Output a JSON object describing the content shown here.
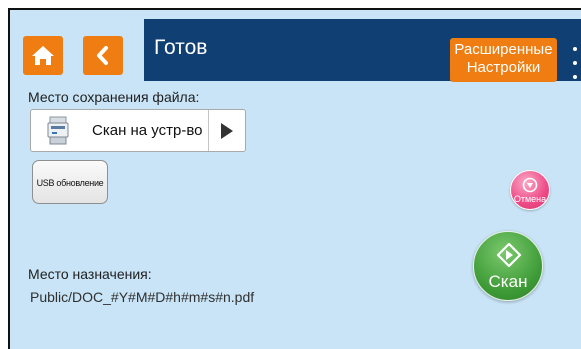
{
  "header": {
    "title": "Готов",
    "advanced_settings_label": "Расширенные Настройки"
  },
  "save_location": {
    "label": "Место сохранения файла:",
    "selected_value": "Скан на устр-во"
  },
  "usb_update": {
    "label": "USB обновление"
  },
  "cancel": {
    "label": "Отмена"
  },
  "destination": {
    "label": "Место назначения:",
    "path": "Public/DOC_#Y#M#D#h#m#s#n.pdf"
  },
  "scan": {
    "label": "Скан"
  },
  "icons": {
    "home": "home-icon",
    "back": "chevron-left-icon",
    "menu": "more-vertical-icon",
    "scanner": "scanner-icon",
    "next": "play-icon",
    "cancel": "stop-icon",
    "scan": "diamond-start-icon"
  },
  "colors": {
    "background": "#c8e4f6",
    "header": "#0f3f73",
    "accent_orange": "#ef7d11",
    "cancel_pink": "#ee4a86",
    "scan_green": "#3d9a36"
  }
}
